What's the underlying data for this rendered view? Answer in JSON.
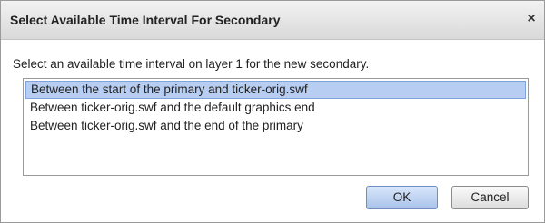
{
  "dialog": {
    "title": "Select Available Time Interval For Secondary",
    "close_glyph": "×",
    "prompt": "Select an available time interval on layer 1 for the new secondary.",
    "options": [
      "Between the start of the primary and ticker-orig.swf",
      "Between ticker-orig.swf and the default graphics end",
      "Between ticker-orig.swf and the end of the primary"
    ],
    "selected_index": 0,
    "ok_label": "OK",
    "cancel_label": "Cancel"
  },
  "colors": {
    "selection": "#b7cef2",
    "titlebar": "#e0e0e0"
  }
}
